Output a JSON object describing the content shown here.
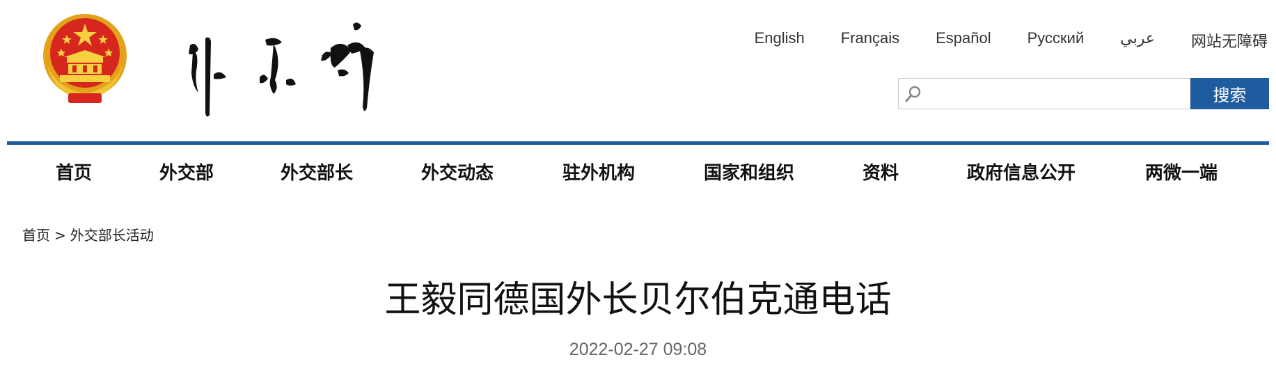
{
  "header": {
    "languages": [
      "English",
      "Français",
      "Español",
      "Русский",
      "عربي",
      "网站无障碍"
    ],
    "search": {
      "placeholder": "",
      "value": "",
      "button_label": "搜索",
      "icon": "search-icon"
    }
  },
  "nav": {
    "items": [
      "首页",
      "外交部",
      "外交部长",
      "外交动态",
      "驻外机构",
      "国家和组织",
      "资料",
      "政府信息公开",
      "两微一端"
    ]
  },
  "breadcrumb": {
    "home": "首页",
    "separator": ">",
    "section": "外交部长活动"
  },
  "article": {
    "title": "王毅同德国外长贝尔伯克通电话",
    "date": "2022-02-27 09:08"
  },
  "colors": {
    "accent": "#1e5b9f",
    "emblem_red": "#d7261e",
    "emblem_gold": "#f1c232"
  }
}
